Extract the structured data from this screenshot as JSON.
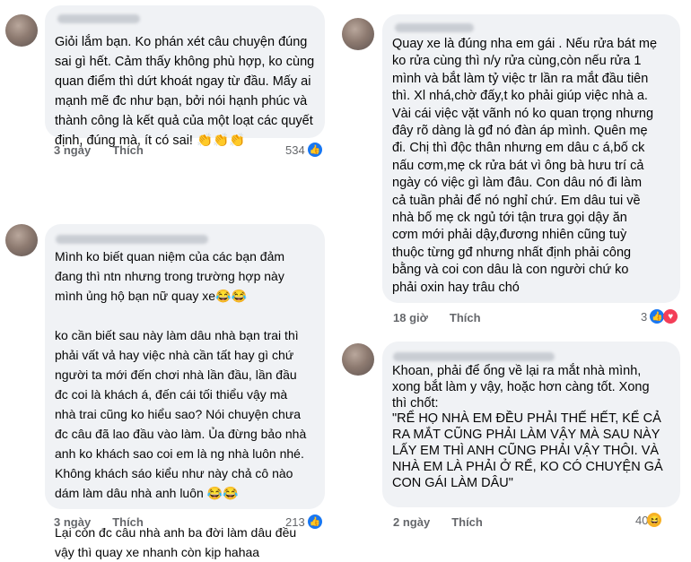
{
  "comments": [
    {
      "text": "Giỏi lắm bạn. Ko phán xét câu chuyện đúng\nsai gì hết. Cảm thấy không phù hợp, ko cùng\nquan điểm thì dứt khoát ngay từ đầu. Mấy ai\nmạnh mẽ đc như bạn, bởi nói hạnh phúc và\nthành công là kết quả của một loạt các quyết\nđịnh, đúng mà, ít có sai! 👏👏👏",
      "time": "3 ngày",
      "like_label": "Thích",
      "count": "534",
      "reactions": [
        "like-icon"
      ]
    },
    {
      "text": "Mình ko biết quan niệm của các bạn đảm\nđang thì ntn nhưng trong trường hợp này\nmình ủng hộ bạn nữ quay xe😂😂\n\nko cần biết sau này làm dâu nhà bạn trai thì\nphải vất vả hay việc nhà cần tất hay gì chứ\nngười ta mới đến chơi nhà lần đầu, lần đầu\nđc coi là khách á, đến cái tối thiểu vậy mà\nnhà trai cũng ko hiểu sao? Nói chuyện chưa\nđc câu đã lao đầu vào làm. Ủa đừng bảo nhà\nanh ko khách sao coi em là ng nhà luôn nhé.\nKhông khách sáo kiểu như này chả cô nào\ndám làm dâu nhà anh luôn 😂😂\n\nLại còn đc câu nhà anh ba đời làm dâu đều\nvậy thì quay xe nhanh còn kịp hahaa",
      "time": "3 ngày",
      "like_label": "Thích",
      "count": "213",
      "reactions": [
        "like-icon"
      ]
    },
    {
      "text": "Quay xe là đúng nha em gái . Nếu rửa bát mẹ\nko rửa cùng thì n/y rửa cùng,còn nếu rửa 1\nmình và bắt làm tỷ việc tr lần ra mắt đầu tiên\nthì. Xl nhá,chờ đấy,t ko phải giúp việc nhà a.\nVài cái việc vặt vãnh nó ko quan trọng nhưng\nđây rõ dàng là gđ nó đàn áp mình. Quên mẹ\nđi. Chị thì độc thân nhưng em dâu c á,bố ck\nnấu cơm,mẹ ck rửa bát vì ông bà hưu trí cả\nngày có việc gì làm đâu. Con dâu nó đi làm\ncả tuần phải để nó nghỉ chứ. Em dâu tui về\nnhà bố mẹ ck ngủ tới tận trưa gọi dậy ăn\ncơm mới phải dậy,đương nhiên cũng tuỳ\nthuộc từng gđ nhưng nhất định phải công\nbằng và coi con dâu là con người chứ ko\nphải oxin hay trâu chó",
      "time": "18 giờ",
      "like_label": "Thích",
      "count": "3",
      "reactions": [
        "like-icon",
        "heart-icon"
      ]
    },
    {
      "text": "Khoan, phải để ổng về lại ra mắt nhà mình,\nxong bắt làm y vậy, hoặc hơn càng tốt. Xong\nthì chốt:\n\"RỂ HỌ NHÀ EM ĐỀU PHẢI THẾ HẾT, KỂ CẢ\nRA MẮT CŨNG PHẢI LÀM VẬY MÀ SAU NÀY\nLẤY EM THÌ ANH CŨNG PHẢI VẬY THÔI. VÀ\nNHÀ EM LÀ PHẢI Ở RỂ, KO CÓ CHUYỆN GẢ\nCON GÁI LÀM DÂU\"",
      "time": "2 ngày",
      "like_label": "Thích",
      "count": "40",
      "reactions": [
        "haha-icon"
      ]
    }
  ]
}
